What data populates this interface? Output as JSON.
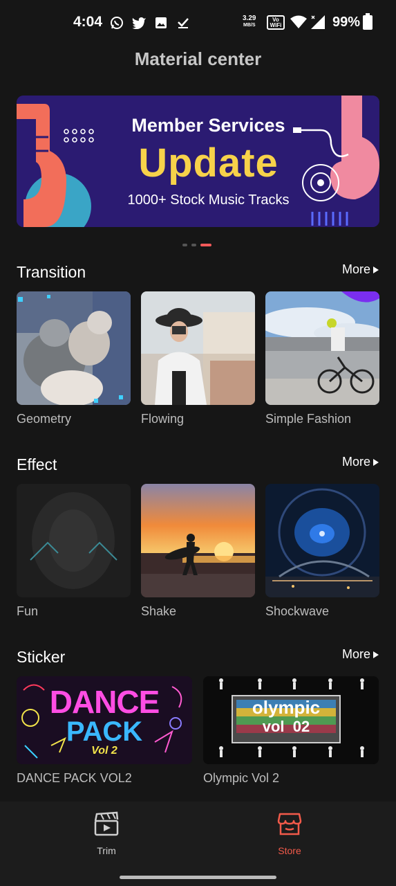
{
  "status_bar": {
    "time": "4:04",
    "net_rate": "3.29",
    "net_unit": "MB/S",
    "vowifi": "Vo WiFi",
    "battery": "99%",
    "icons": [
      "whatsapp-icon",
      "twitter-icon",
      "image-icon",
      "download-done-icon"
    ]
  },
  "header": {
    "title": "Material center"
  },
  "banner": {
    "line1": "Member Services",
    "line2": "Update",
    "line3": "1000+ Stock Music Tracks",
    "page_count": 3,
    "active_page": 3
  },
  "sections": {
    "transition": {
      "title": "Transition",
      "more": "More",
      "items": [
        {
          "label": "Geometry"
        },
        {
          "label": "Flowing"
        },
        {
          "label": "Simple Fashion"
        }
      ]
    },
    "effect": {
      "title": "Effect",
      "more": "More",
      "items": [
        {
          "label": "Fun"
        },
        {
          "label": "Shake"
        },
        {
          "label": "Shockwave"
        }
      ]
    },
    "sticker": {
      "title": "Sticker",
      "more": "More",
      "items": [
        {
          "label": "DANCE PACK VOL2",
          "art_line1": "DANCE",
          "art_line2": "PACK",
          "art_line3": "Vol 2"
        },
        {
          "label": "Olympic Vol 2",
          "art_line1": "olympic",
          "art_line2": "vol  02"
        }
      ]
    }
  },
  "bottom_nav": {
    "items": [
      {
        "label": "Trim",
        "icon": "clapperboard-icon",
        "active": false
      },
      {
        "label": "Store",
        "icon": "store-icon",
        "active": true
      }
    ],
    "active_color": "#f25a4a"
  }
}
